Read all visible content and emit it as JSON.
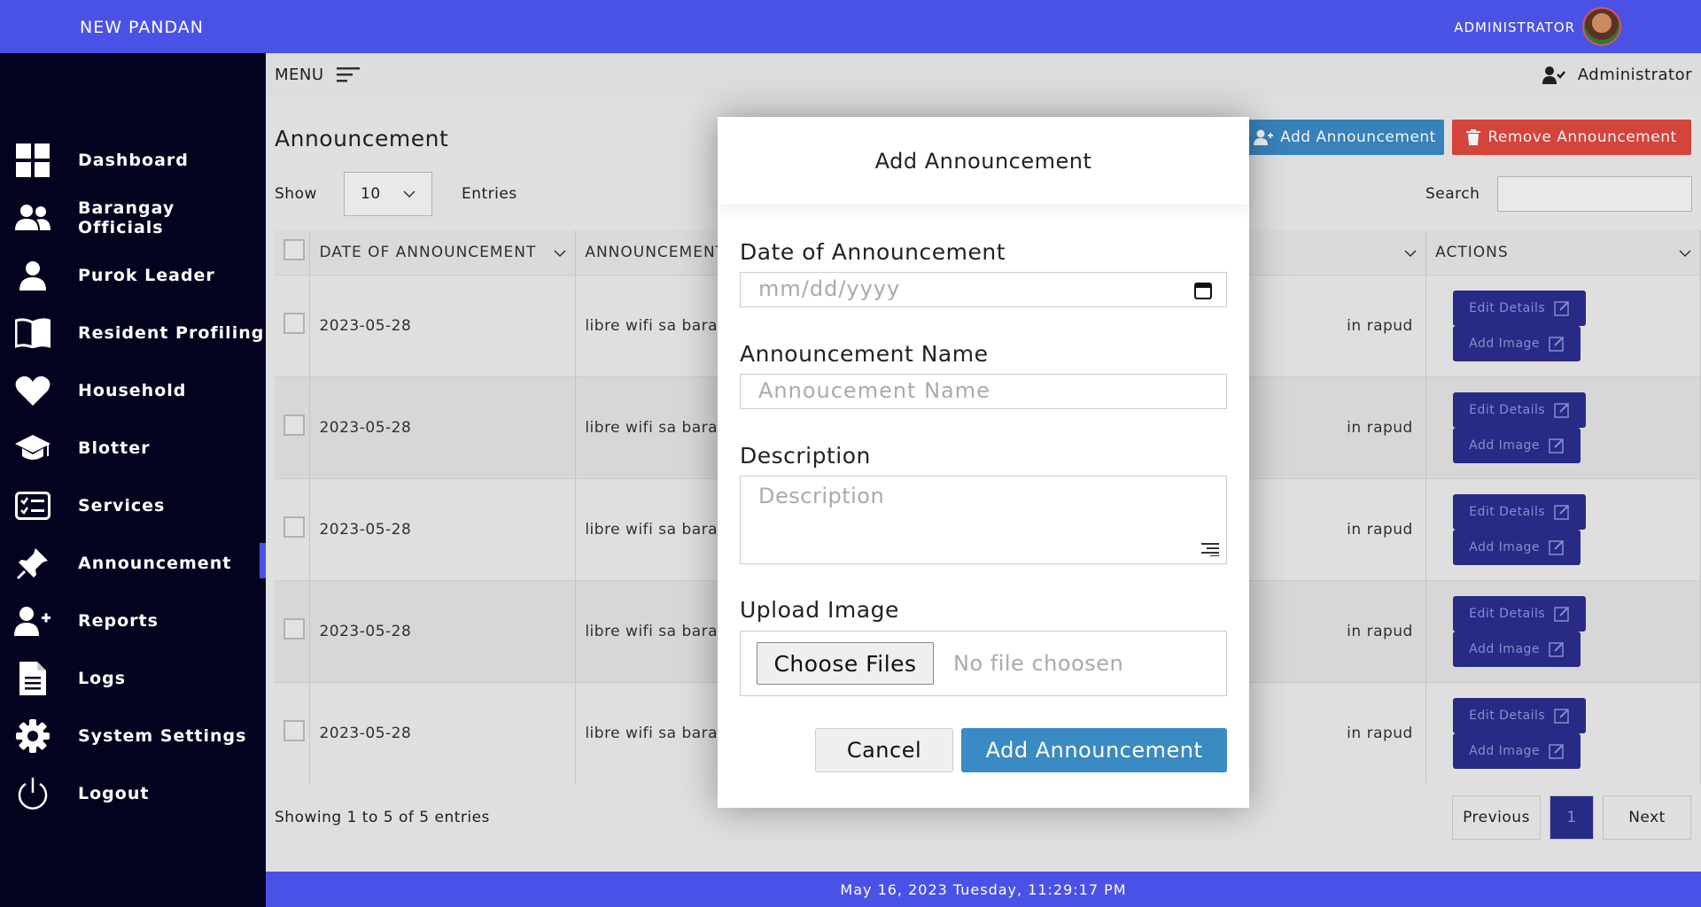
{
  "topbar": {
    "brand": "NEW PANDAN",
    "user": "ADMINISTRATOR"
  },
  "sidebar": {
    "items": [
      {
        "label": "Dashboard",
        "icon": "dashboard-grid-icon"
      },
      {
        "label": "Barangay Officials",
        "icon": "users-icon"
      },
      {
        "label": "Purok Leader",
        "icon": "user-icon"
      },
      {
        "label": "Resident Profiling",
        "icon": "book-icon"
      },
      {
        "label": "Household",
        "icon": "heart-icon"
      },
      {
        "label": "Blotter",
        "icon": "graduation-cap-icon"
      },
      {
        "label": "Services",
        "icon": "checklist-icon"
      },
      {
        "label": "Announcement",
        "icon": "pin-icon",
        "active": true
      },
      {
        "label": "Reports",
        "icon": "user-plus-icon"
      },
      {
        "label": "Logs",
        "icon": "document-icon"
      },
      {
        "label": "System Settings",
        "icon": "gear-icon"
      },
      {
        "label": "Logout",
        "icon": "power-icon"
      }
    ]
  },
  "subbar": {
    "menu": "MENU",
    "admin": "Administrator"
  },
  "page": {
    "title": "Announcement",
    "add_button": "Add Announcement",
    "remove_button": "Remove Announcement",
    "show": "Show",
    "entries_value": "10",
    "entries": "Entries",
    "search": "Search"
  },
  "table": {
    "columns": [
      "DATE OF ANNOUNCEMENT",
      "ANNOUNCEMENT",
      "",
      "ACTIONS"
    ],
    "rows": [
      {
        "date": "2023-05-28",
        "name": "libre wifi sa baran",
        "desc": "in rapud"
      },
      {
        "date": "2023-05-28",
        "name": "libre wifi sa baran",
        "desc": "in rapud"
      },
      {
        "date": "2023-05-28",
        "name": "libre wifi sa baran",
        "desc": "in rapud"
      },
      {
        "date": "2023-05-28",
        "name": "libre wifi sa baran",
        "desc": "in rapud"
      },
      {
        "date": "2023-05-28",
        "name": "libre wifi sa baran",
        "desc": "in rapud"
      }
    ],
    "edit_label": "Edit Details",
    "image_label": "Add Image"
  },
  "footer": {
    "info": "Showing 1 to 5 of 5 entries",
    "previous": "Previous",
    "page": "1",
    "next": "Next",
    "datetime": "May 16, 2023 Tuesday, 11:29:17 PM"
  },
  "modal": {
    "title": "Add Announcement",
    "date_label": "Date of Announcement",
    "date_placeholder": "mm/dd/yyyy",
    "name_label": "Announcement Name",
    "name_placeholder": "Annoucement Name",
    "desc_label": "Description",
    "desc_placeholder": "Description",
    "upload_label": "Upload Image",
    "choose_files": "Choose Files",
    "no_file": "No file choosen",
    "cancel": "Cancel",
    "submit": "Add Announcement"
  },
  "colors": {
    "primary": "#4a52e6",
    "sidebar": "#03031f",
    "accent_blue": "#3a8ac4",
    "danger": "#e0483f"
  }
}
